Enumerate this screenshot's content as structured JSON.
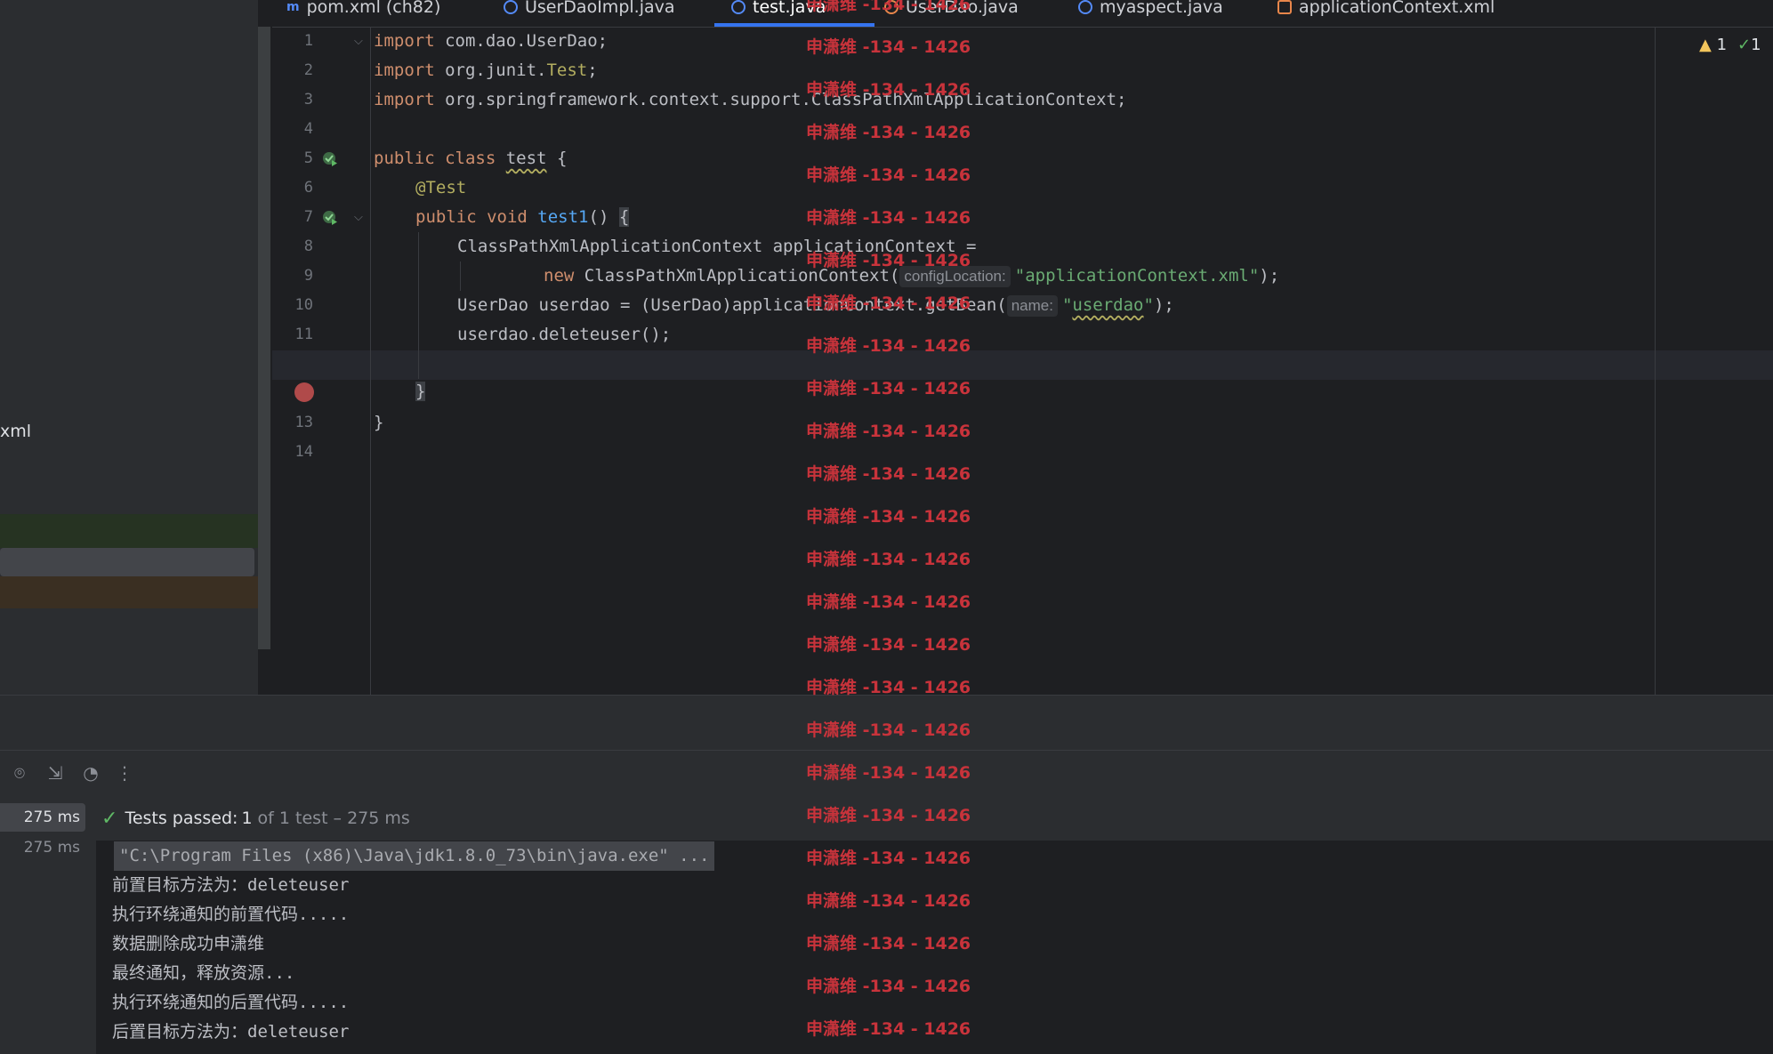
{
  "project_panel": {
    "partial_label": "xml"
  },
  "tabs": [
    {
      "label": "pom.xml (ch82)",
      "icon": "maven-icon"
    },
    {
      "label": "UserDaoImpl.java",
      "icon": "class-icon"
    },
    {
      "label": "test.java",
      "icon": "class-icon",
      "active": true
    },
    {
      "label": "UserDao.java",
      "icon": "interface-icon"
    },
    {
      "label": "myaspect.java",
      "icon": "class-icon"
    },
    {
      "label": "applicationContext.xml",
      "icon": "xml-icon"
    }
  ],
  "inspections": {
    "warnings": "1",
    "weak_warnings": "1"
  },
  "line_numbers": [
    "1",
    "2",
    "3",
    "4",
    "5",
    "6",
    "7",
    "8",
    "9",
    "10",
    "11",
    "",
    "13",
    "14"
  ],
  "code": {
    "l1_kw": "import",
    "l1": " com.dao.UserDao;",
    "l2_kw": "import",
    "l2a": " org.junit.",
    "l2b": "Test",
    "l2c": ";",
    "l3_kw": "import",
    "l3": " org.springframework.context.support.ClassPathXmlApplicationContext;",
    "l5_kw": "public class",
    "l5_name": "test",
    "l5_rest": " {",
    "l6_ann": "@Test",
    "l7_kw": "public void",
    "l7_fn": "test1",
    "l7_paren": "() ",
    "l7_brace": "{",
    "l8": "ClassPathXmlApplicationContext applicationContext =",
    "l9_kw": "new",
    "l9_rest": " ClassPathXmlApplicationContext(",
    "l9_hint": "configLocation:",
    "l9_str": "\"applicationContext.xml\"",
    "l9_end": ");",
    "l10_a": "UserDao userdao = (UserDao)applicationContext.getBean(",
    "l10_hint": "name:",
    "l10_q1": "\"",
    "l10_str": "userdao",
    "l10_q2": "\"",
    "l10_end": ");",
    "l11": "userdao.deleteuser();",
    "l12": "}",
    "l13": "}"
  },
  "run_panel": {
    "tree": [
      {
        "time": "275 ms",
        "selected": true
      },
      {
        "time": "275 ms"
      }
    ],
    "status_label": "Tests passed:",
    "status_count": "1",
    "status_rest": "of 1 test – 275 ms"
  },
  "console": [
    "\"C:\\Program Files (x86)\\Java\\jdk1.8.0_73\\bin\\java.exe\" ...",
    "前置目标方法为：deleteuser",
    "执行环绕通知的前置代码.....",
    "数据删除成功申潇维",
    "最终通知，释放资源...",
    "执行环绕通知的后置代码.....",
    "后置目标方法为：deleteuser"
  ],
  "watermark_text": "申潇维 -134 - 1426",
  "colors": {
    "accent": "#3574f0",
    "keyword": "#cf8e6d",
    "string": "#6aab73",
    "function": "#56a8f5",
    "annotation": "#b3ae60",
    "watermark": "#c8333b",
    "pass": "#5fb865"
  }
}
